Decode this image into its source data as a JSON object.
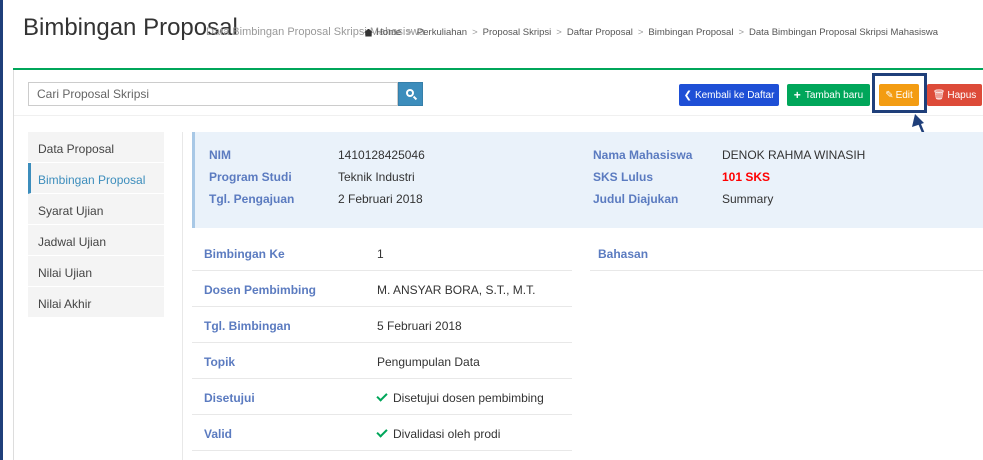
{
  "header": {
    "title": "Bimbingan Proposal",
    "subtitle": "Data Bimbingan Proposal Skripsi Mahasiswa",
    "breadcrumb": [
      "Home",
      "Perkuliahan",
      "Proposal Skripsi",
      "Daftar Proposal",
      "Bimbingan Proposal",
      "Data Bimbingan Proposal Skripsi Mahasiswa"
    ]
  },
  "toolbar": {
    "search_placeholder": "Cari Proposal Skripsi",
    "back_label": "Kembali ke Daftar",
    "add_label": "Tambah baru",
    "edit_label": "Edit",
    "delete_label": "Hapus"
  },
  "sidebar": {
    "items": [
      {
        "label": "Data Proposal"
      },
      {
        "label": "Bimbingan Proposal"
      },
      {
        "label": "Syarat Ujian"
      },
      {
        "label": "Jadwal Ujian"
      },
      {
        "label": "Nilai Ujian"
      },
      {
        "label": "Nilai Akhir"
      }
    ],
    "active_index": 1
  },
  "student": {
    "nim_label": "NIM",
    "nim": "1410128425046",
    "prodi_label": "Program Studi",
    "prodi": "Teknik Industri",
    "tgl_label": "Tgl. Pengajuan",
    "tgl": "2 Februari 2018",
    "nama_label": "Nama Mahasiswa",
    "nama": "DENOK RAHMA WINASIH",
    "sks_label": "SKS Lulus",
    "sks": "101 SKS",
    "judul_label": "Judul Diajukan",
    "judul": "Summary"
  },
  "bimbingan": {
    "rows": [
      {
        "label": "Bimbingan Ke",
        "value": "1"
      },
      {
        "label": "Dosen Pembimbing",
        "value": "M. ANSYAR BORA, S.T., M.T."
      },
      {
        "label": "Tgl. Bimbingan",
        "value": "5 Februari 2018"
      },
      {
        "label": "Topik",
        "value": "Pengumpulan Data"
      },
      {
        "label": "Disetujui",
        "value": "Disetujui dosen pembimbing"
      },
      {
        "label": "Valid",
        "value": "Divalidasi oleh prodi"
      }
    ],
    "bahasan_label": "Bahasan"
  },
  "colors": {
    "primary": "#3c8dbc",
    "success": "#00a65a",
    "warning": "#f39c12",
    "danger": "#dd4b39",
    "label": "#5b7bc0"
  }
}
